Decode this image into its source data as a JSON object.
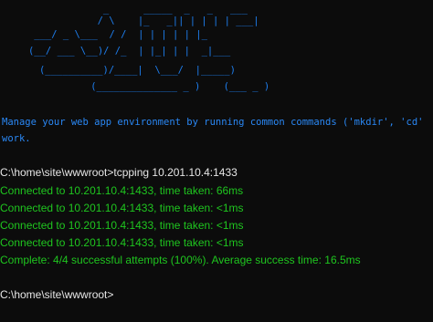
{
  "ascii_logo": [
    "         _      _____  _   _   ___ ",
    "        / \\    |_   _|| | | | | ___|",
    "    ___/ _ \\___  / /  | | | | | |_",
    "   (__/ ___ \\__)/ /_  | |_| | |  _|___",
    "   (__________)/____|  \\___/  |_____)",
    "          (______________ _ )    (___ _ )"
  ],
  "banner": {
    "line1": "Manage your web app environment by running common commands ('mkdir', 'cd'",
    "line2": "work."
  },
  "session": {
    "prompt1": "C:\\home\\site\\wwwroot>tcpping 10.201.10.4:1433",
    "outputs": [
      "Connected to 10.201.10.4:1433, time taken: 66ms",
      "Connected to 10.201.10.4:1433, time taken: <1ms",
      "Connected to 10.201.10.4:1433, time taken: <1ms",
      "Connected to 10.201.10.4:1433, time taken: <1ms",
      "Complete: 4/4 successful attempts (100%). Average success time: 16.5ms"
    ],
    "prompt2": "C:\\home\\site\\wwwroot>"
  },
  "colors": {
    "background": "#0c0c0c",
    "ascii_blue": "#1e7ff0",
    "banner_blue": "#2a88f5",
    "prompt_white": "#e6e6e6",
    "output_green": "#1fc61f"
  }
}
